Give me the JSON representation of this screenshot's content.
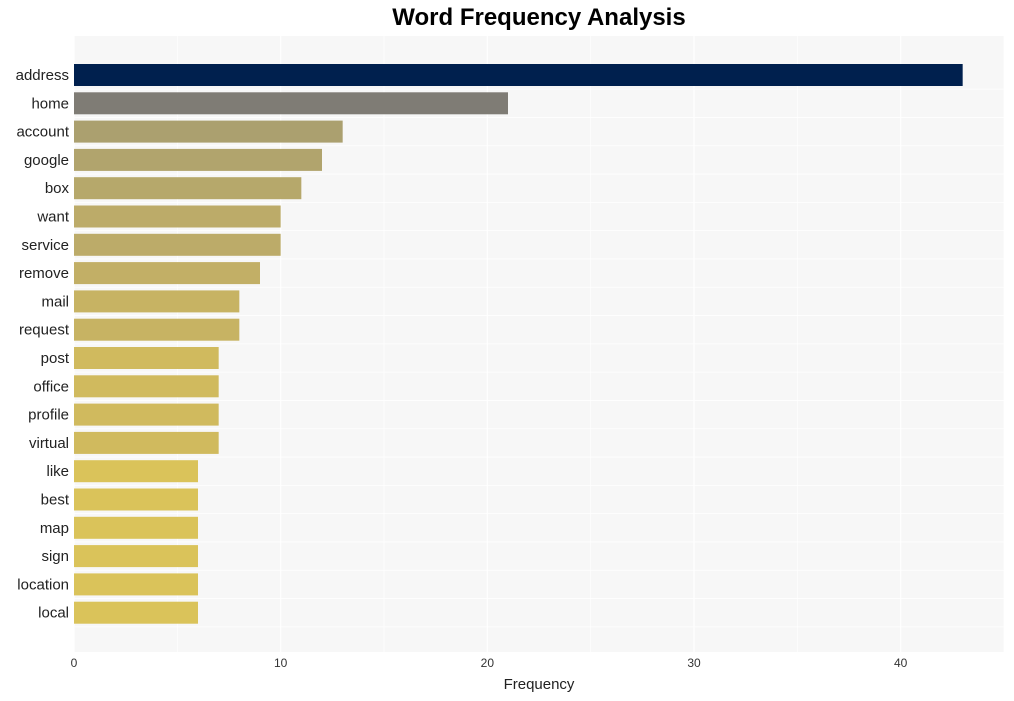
{
  "chart_data": {
    "type": "bar",
    "orientation": "horizontal",
    "title": "Word Frequency Analysis",
    "xlabel": "Frequency",
    "ylabel": "",
    "xlim": [
      0,
      45
    ],
    "xticks": [
      0,
      10,
      20,
      30,
      40
    ],
    "grid": true,
    "legend": "none",
    "categories": [
      "address",
      "home",
      "account",
      "google",
      "box",
      "want",
      "service",
      "remove",
      "mail",
      "request",
      "post",
      "office",
      "profile",
      "virtual",
      "like",
      "best",
      "map",
      "sign",
      "location",
      "local"
    ],
    "values": [
      43,
      21,
      13,
      12,
      11,
      10,
      10,
      9,
      8,
      8,
      7,
      7,
      7,
      7,
      6,
      6,
      6,
      6,
      6,
      6
    ],
    "colors": [
      "#00204e",
      "#7f7c75",
      "#aba06f",
      "#b1a46d",
      "#b6a86b",
      "#bcab69",
      "#bcab69",
      "#c2af66",
      "#c7b363",
      "#c7b363",
      "#d0ba5e",
      "#d0ba5e",
      "#d0ba5e",
      "#d0ba5e",
      "#dac35a",
      "#dac35a",
      "#dac35a",
      "#dac35a",
      "#dac35a",
      "#dac35a"
    ],
    "background": "#f7f7f7"
  }
}
